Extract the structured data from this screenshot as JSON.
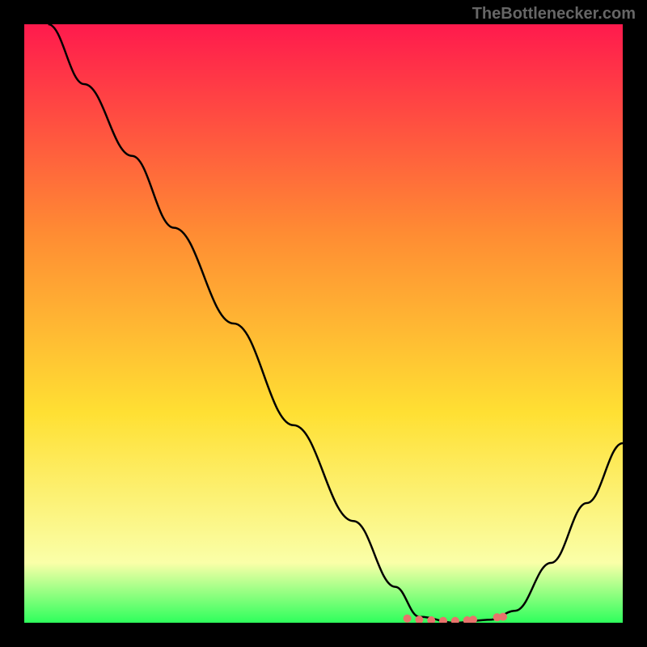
{
  "watermark": "TheBottlenecker.com",
  "chart_data": {
    "type": "line",
    "title": "",
    "xlabel": "",
    "ylabel": "",
    "xlim": [
      0,
      100
    ],
    "ylim": [
      0,
      100
    ],
    "gradient_colors": {
      "top": "#ff1a4d",
      "mid1": "#ff8c33",
      "mid2": "#ffe033",
      "mid3": "#faffa8",
      "bottom": "#2eff5c"
    },
    "series": [
      {
        "name": "curve",
        "color": "#000000",
        "points": [
          {
            "x": 4,
            "y": 100
          },
          {
            "x": 10,
            "y": 90
          },
          {
            "x": 18,
            "y": 78
          },
          {
            "x": 25,
            "y": 66
          },
          {
            "x": 35,
            "y": 50
          },
          {
            "x": 45,
            "y": 33
          },
          {
            "x": 55,
            "y": 17
          },
          {
            "x": 62,
            "y": 6
          },
          {
            "x": 66,
            "y": 1
          },
          {
            "x": 72,
            "y": 0
          },
          {
            "x": 78,
            "y": 0.5
          },
          {
            "x": 82,
            "y": 2
          },
          {
            "x": 88,
            "y": 10
          },
          {
            "x": 94,
            "y": 20
          },
          {
            "x": 100,
            "y": 30
          }
        ]
      }
    ],
    "markers": {
      "color": "#e8736b",
      "points": [
        {
          "x": 64,
          "y": 0.7
        },
        {
          "x": 66,
          "y": 0.5
        },
        {
          "x": 68,
          "y": 0.4
        },
        {
          "x": 70,
          "y": 0.3
        },
        {
          "x": 72,
          "y": 0.3
        },
        {
          "x": 74,
          "y": 0.4
        },
        {
          "x": 75,
          "y": 0.5
        },
        {
          "x": 79,
          "y": 0.9
        },
        {
          "x": 80,
          "y": 1.0
        }
      ]
    }
  }
}
